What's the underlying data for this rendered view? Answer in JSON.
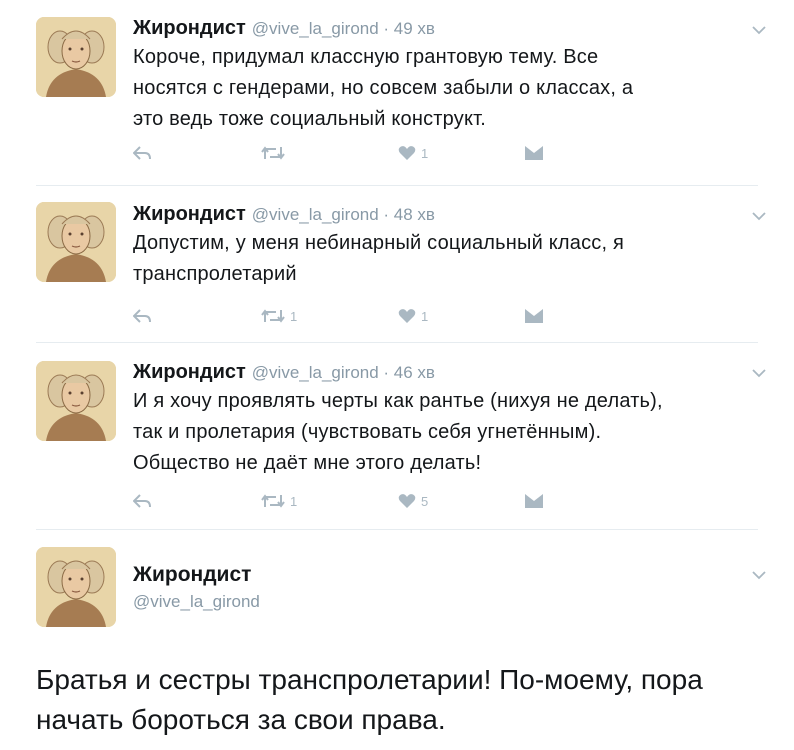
{
  "tweets": [
    {
      "name": "Жирондист",
      "handle": "@vive_la_girond · 49 хв",
      "text": [
        "Короче, придумал классную грантовую тему. Все",
        "носятся с гендерами, но совсем забыли о классах, а",
        "это ведь тоже социальный конструкт."
      ],
      "retweets": "",
      "likes": "1"
    },
    {
      "name": "Жирондист",
      "handle": "@vive_la_girond · 48 хв",
      "text": [
        "Допустим, у меня небинарный социальный класс, я",
        "транспролетарий"
      ],
      "retweets": "1",
      "likes": "1"
    },
    {
      "name": "Жирондист",
      "handle": "@vive_la_girond · 46 хв",
      "text": [
        "И я хочу проявлять черты как рантье (нихуя не делать),",
        "так и пролетария (чувствовать себя угнетённым).",
        "Общество не даёт мне этого делать!"
      ],
      "retweets": "1",
      "likes": "5"
    }
  ],
  "focused": {
    "name": "Жирондист",
    "handle": "@vive_la_girond",
    "text": [
      "Братья и сестры транспролетарии! По-моему, пора",
      "начать бороться за свои права."
    ]
  },
  "icons": {
    "reply": "reply-icon",
    "retweet": "retweet-icon",
    "like": "heart-icon",
    "dm": "direct-message-icon",
    "more": "chevron-down-icon"
  },
  "colors": {
    "action_gray": "#aab8c2",
    "handle_gray": "#8899a6",
    "text": "#14171a"
  }
}
